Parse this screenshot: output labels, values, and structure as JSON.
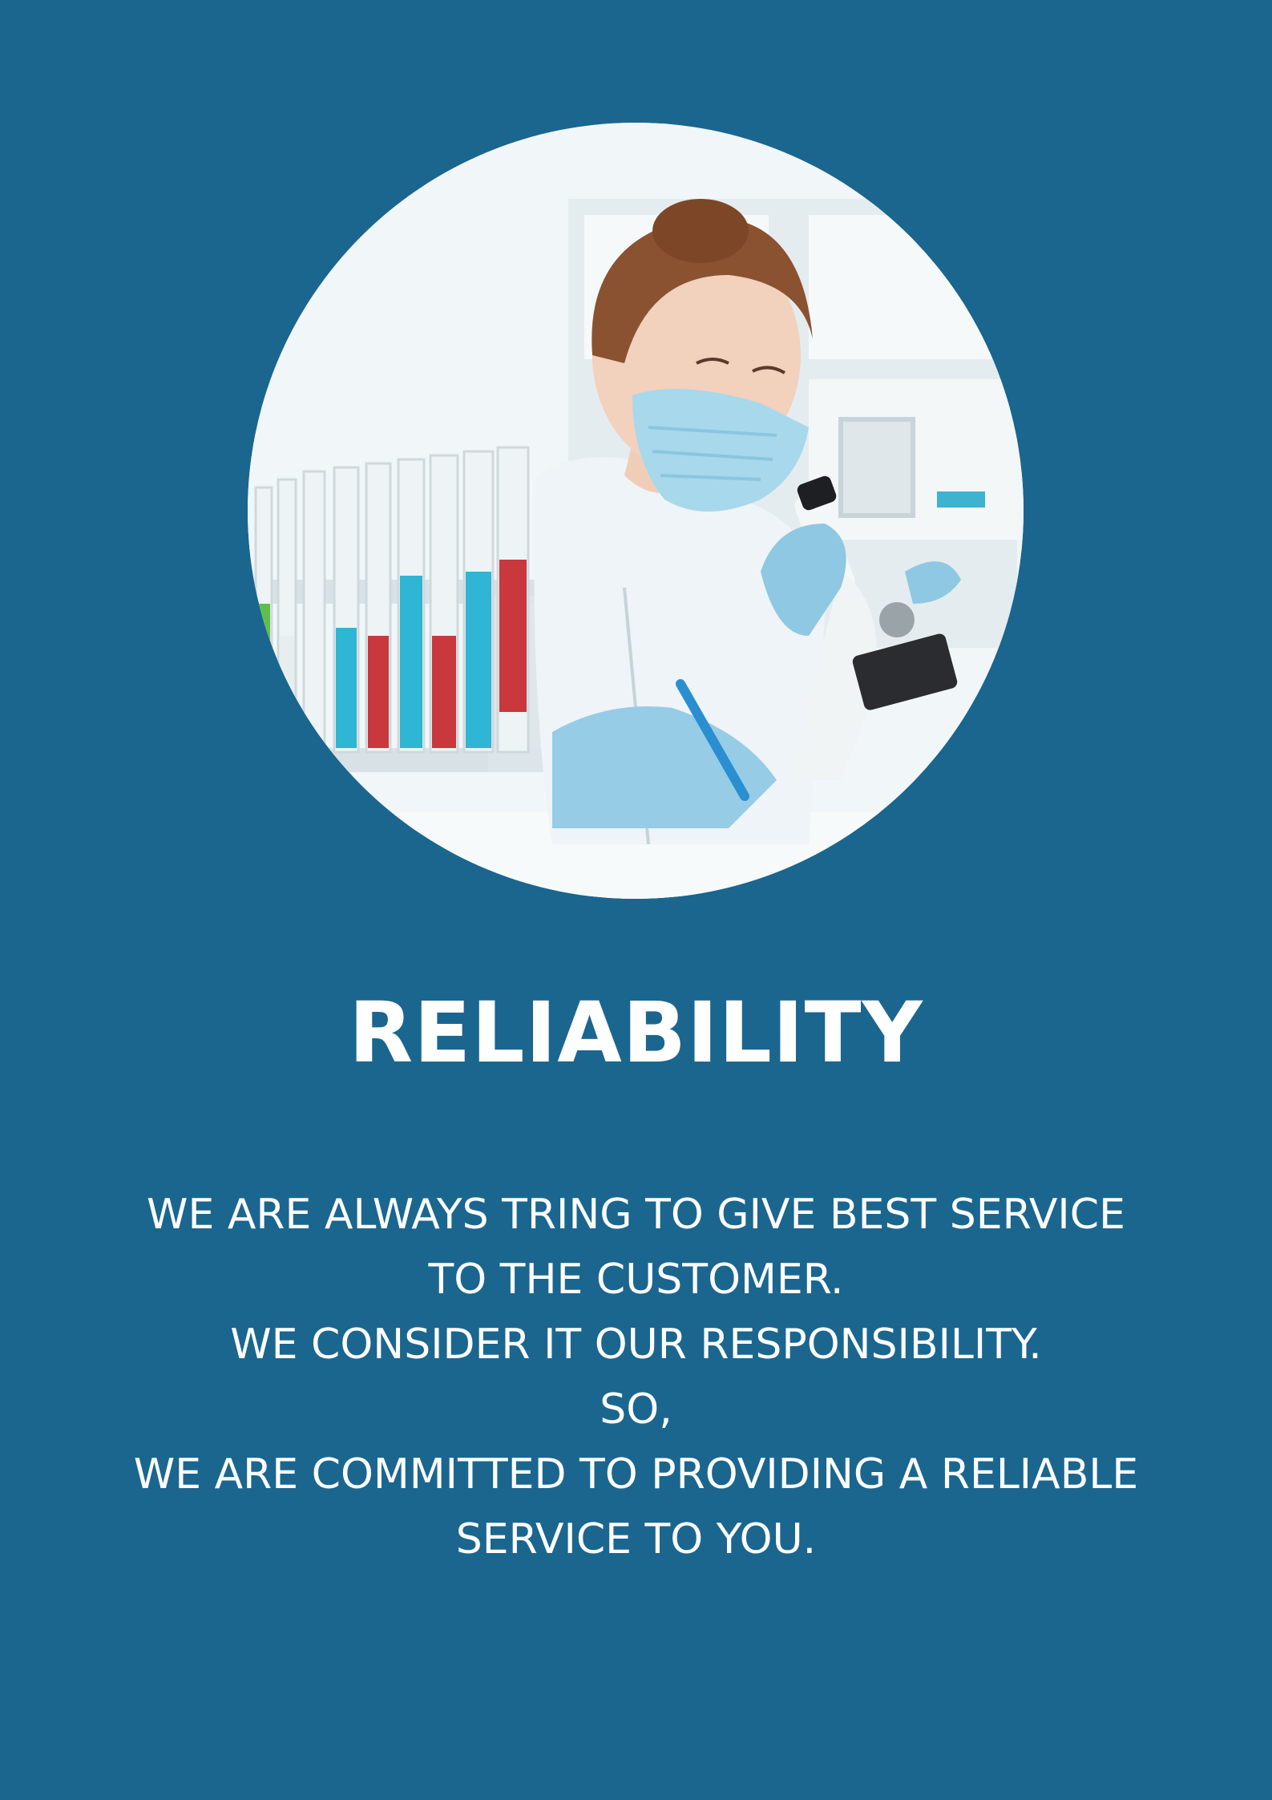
{
  "page": {
    "background_color": "#1a668f",
    "text_color": "#ffffff"
  },
  "image": {
    "icon": "lab-scientist-microscope-photo"
  },
  "title": "RELIABILITY",
  "body_lines": [
    "WE ARE ALWAYS TRING TO GIVE BEST SERVICE",
    "TO THE CUSTOMER.",
    "WE CONSIDER IT OUR RESPONSIBILITY.",
    "SO,",
    "WE ARE COMMITTED TO PROVIDING A RELIABLE",
    "SERVICE TO YOU."
  ]
}
